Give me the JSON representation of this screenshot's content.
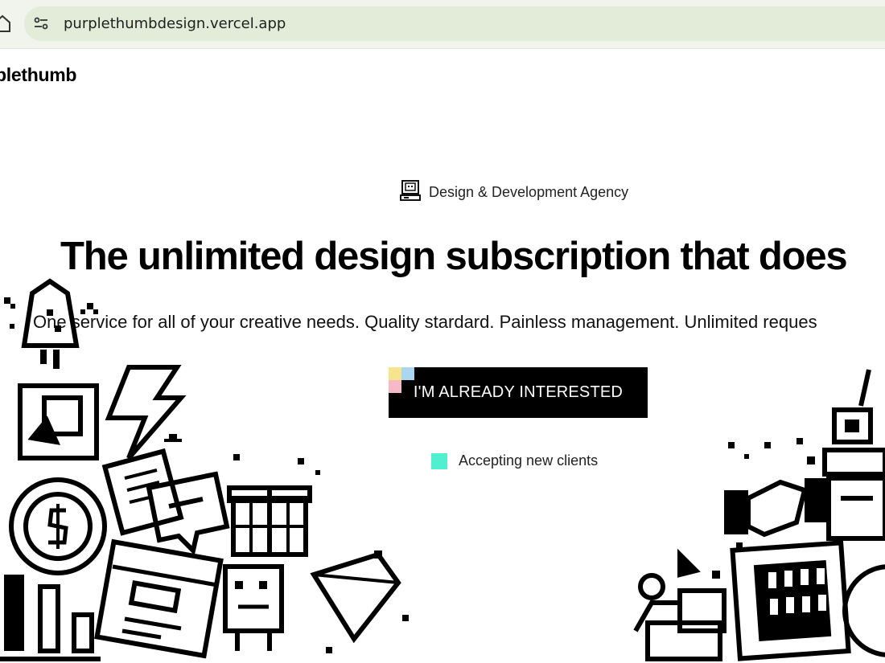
{
  "browser": {
    "url": "purplethumbdesign.vercel.app"
  },
  "nav": {
    "logo": "plethumb"
  },
  "hero": {
    "tagline": "Design & Development Agency",
    "headline": "The unlimited design subscription that does",
    "subheadline": "One service for all of your creative needs. Quality stardard. Painless management. Unlimited reques",
    "cta_label": "I'M ALREADY INTERESTED",
    "status_text": "Accepting new clients"
  },
  "colors": {
    "status_dot": "#4ef0cf",
    "cta_background": "#000000",
    "cta_accent_yellow": "#f6e58d",
    "cta_accent_blue": "#a9d6f0",
    "cta_accent_pink": "#f6b9c7"
  },
  "icons": {
    "tagline_icon": "computer-icon",
    "site_info_icon": "tune-icon",
    "home_icon": "home-icon"
  }
}
